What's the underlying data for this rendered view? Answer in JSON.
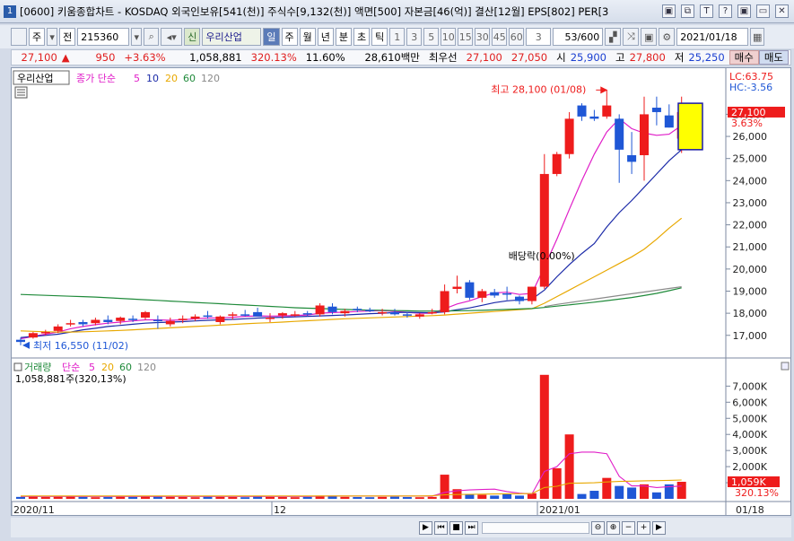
{
  "window": {
    "title": "[0600] 키움종합차트 - KOSDAQ 외국인보유[541(천)] 주식수[9,132(천)] 액면[500] 자본금[46(억)] 결산[12월] EPS[802] PER[3",
    "badge": "1",
    "buttons": [
      "▣",
      "⧉",
      "T",
      "?",
      "▣",
      "▭",
      "✕"
    ]
  },
  "toolbar": {
    "mode": "주",
    "all": "전",
    "code": "215360",
    "new_label": "신",
    "stock_name": "우리산업",
    "periods": [
      "일",
      "주",
      "월",
      "년",
      "분",
      "초",
      "틱"
    ],
    "numbers": [
      "1",
      "3",
      "5",
      "10",
      "15",
      "30",
      "45",
      "60"
    ],
    "count_select": "3",
    "count": "53/600",
    "date": "2021/01/18"
  },
  "info": {
    "price": "27,100",
    "change": "950",
    "change_pct": "+3.63%",
    "volume": "1,058,881",
    "volume_pct": "320.13%",
    "turnover": "11.60%",
    "amount": "28,610백만",
    "priority": "최우선",
    "ask": "27,100",
    "bid": "27,050",
    "open_label": "시",
    "open": "25,900",
    "high_label": "고",
    "high": "27,800",
    "low_label": "저",
    "low": "25,250",
    "buy": "매수",
    "sell": "매도"
  },
  "colors": {
    "up": "#ee1c1c",
    "down": "#1f57d6",
    "ma5": "#e01ec8",
    "ma10": "#1b2aa8",
    "ma20": "#e8a800",
    "ma60": "#1f8a3a",
    "ma120": "#8a8a8a"
  },
  "chart_data": [
    {
      "type": "candlestick",
      "legend": [
        "우리산업",
        "종가 단순",
        "5",
        "10",
        "20",
        "60",
        "120"
      ],
      "ylim": [
        16300,
        28600
      ],
      "yticks": [
        "17,000",
        "18,000",
        "19,000",
        "20,000",
        "21,000",
        "22,000",
        "23,000",
        "24,000",
        "25,000",
        "26,000",
        "27,000"
      ],
      "xlabels": [
        "2020/11",
        "12",
        "2021/01",
        "01/18"
      ],
      "high_annotation": "최고 28,100 (01/08)",
      "low_annotation": "최저 16,550 (11/02)",
      "event_annotation": "배당락(0.00%)",
      "lc": "LC:63.75",
      "hc": "HC:-3.56",
      "last_price": "27,100",
      "last_pct": "3.63%",
      "candles": [
        [
          16800,
          16900,
          16550,
          16700
        ],
        [
          16900,
          17150,
          16850,
          17100
        ],
        [
          17100,
          17250,
          17000,
          17150
        ],
        [
          17200,
          17500,
          17100,
          17400
        ],
        [
          17500,
          17700,
          17400,
          17550
        ],
        [
          17600,
          17700,
          17400,
          17500
        ],
        [
          17550,
          17800,
          17450,
          17700
        ],
        [
          17700,
          17900,
          17500,
          17600
        ],
        [
          17650,
          17850,
          17500,
          17800
        ],
        [
          17750,
          17900,
          17600,
          17700
        ],
        [
          17800,
          18100,
          17700,
          18050
        ],
        [
          17700,
          17900,
          17300,
          17650
        ],
        [
          17500,
          17800,
          17400,
          17650
        ],
        [
          17700,
          17900,
          17550,
          17750
        ],
        [
          17750,
          17950,
          17650,
          17850
        ],
        [
          17900,
          18100,
          17750,
          17850
        ],
        [
          17600,
          17900,
          17500,
          17850
        ],
        [
          17900,
          18050,
          17700,
          17950
        ],
        [
          17950,
          18150,
          17850,
          17900
        ],
        [
          18050,
          18250,
          17950,
          17850
        ],
        [
          17750,
          18000,
          17600,
          17800
        ],
        [
          17900,
          18050,
          17750,
          18000
        ],
        [
          17950,
          18100,
          17850,
          17950
        ],
        [
          18000,
          18100,
          17850,
          17950
        ],
        [
          17950,
          18450,
          17850,
          18350
        ],
        [
          18300,
          18450,
          17950,
          18050
        ],
        [
          18000,
          18200,
          17850,
          18100
        ],
        [
          18200,
          18300,
          18050,
          18150
        ],
        [
          18150,
          18250,
          18050,
          18100
        ],
        [
          18000,
          18200,
          17900,
          18050
        ],
        [
          18050,
          18200,
          17900,
          17950
        ],
        [
          17950,
          18050,
          17800,
          17900
        ],
        [
          17850,
          18000,
          17750,
          17950
        ],
        [
          18000,
          18200,
          17950,
          18050
        ],
        [
          18050,
          19300,
          17950,
          19000
        ],
        [
          19100,
          19700,
          18900,
          19200
        ],
        [
          19400,
          19500,
          18600,
          18700
        ],
        [
          18700,
          19100,
          18500,
          19000
        ],
        [
          18950,
          19100,
          18700,
          18800
        ],
        [
          18900,
          19200,
          18600,
          18850
        ],
        [
          18750,
          18800,
          18400,
          18550
        ],
        [
          18550,
          19200,
          18400,
          19200
        ],
        [
          19200,
          25200,
          19100,
          24300
        ],
        [
          24300,
          25300,
          24200,
          25200
        ],
        [
          25200,
          27100,
          25000,
          26800
        ],
        [
          27400,
          27500,
          26700,
          26900
        ],
        [
          26900,
          27200,
          26700,
          26800
        ],
        [
          26900,
          28100,
          26800,
          27400
        ],
        [
          26800,
          27000,
          23900,
          25400
        ],
        [
          25150,
          26200,
          24300,
          24850
        ],
        [
          25150,
          27800,
          24000,
          27000
        ],
        [
          27300,
          27800,
          26500,
          27100
        ],
        [
          26950,
          27450,
          26400,
          26400
        ],
        [
          25900,
          27800,
          25250,
          27100
        ]
      ],
      "series": [
        {
          "name": "5",
          "values": [
            16850,
            16950,
            17050,
            17150,
            17300,
            17400,
            17480,
            17550,
            17600,
            17650,
            17700,
            17700,
            17680,
            17700,
            17750,
            17780,
            17790,
            17820,
            17860,
            17880,
            17870,
            17880,
            17900,
            17920,
            18000,
            18030,
            18050,
            18080,
            18100,
            18120,
            18080,
            18040,
            18000,
            18000,
            18200,
            18420,
            18560,
            18750,
            18920,
            18950,
            18850,
            18900,
            20100,
            21350,
            22700,
            24000,
            25200,
            26200,
            26800,
            26350,
            26150,
            26050,
            26100,
            26500
          ]
        },
        {
          "name": "10",
          "values": [
            16900,
            16950,
            17000,
            17050,
            17150,
            17250,
            17320,
            17400,
            17450,
            17500,
            17550,
            17580,
            17600,
            17620,
            17650,
            17680,
            17700,
            17720,
            17750,
            17780,
            17800,
            17820,
            17840,
            17860,
            17880,
            17900,
            17920,
            17950,
            17980,
            18000,
            18030,
            18040,
            18030,
            18020,
            18060,
            18160,
            18240,
            18360,
            18480,
            18560,
            18600,
            18640,
            19050,
            19650,
            20200,
            20700,
            21150,
            21900,
            22550,
            23100,
            23700,
            24300,
            24900,
            25400
          ]
        },
        {
          "name": "20",
          "values": [
            17200,
            17180,
            17160,
            17150,
            17150,
            17160,
            17180,
            17200,
            17220,
            17250,
            17280,
            17310,
            17340,
            17370,
            17400,
            17430,
            17460,
            17490,
            17520,
            17550,
            17570,
            17600,
            17630,
            17660,
            17690,
            17720,
            17750,
            17770,
            17790,
            17810,
            17830,
            17850,
            17870,
            17890,
            17920,
            17960,
            18000,
            18040,
            18080,
            18120,
            18160,
            18200,
            18450,
            18750,
            19050,
            19350,
            19650,
            19950,
            20250,
            20550,
            20900,
            21350,
            21850,
            22300
          ]
        },
        {
          "name": "60",
          "values": [
            18850,
            18830,
            18810,
            18790,
            18770,
            18750,
            18730,
            18700,
            18670,
            18640,
            18610,
            18580,
            18550,
            18520,
            18490,
            18460,
            18430,
            18400,
            18370,
            18340,
            18310,
            18280,
            18250,
            18230,
            18210,
            18190,
            18170,
            18150,
            18140,
            18130,
            18120,
            18110,
            18100,
            18100,
            18100,
            18110,
            18120,
            18130,
            18150,
            18170,
            18190,
            18210,
            18260,
            18320,
            18380,
            18440,
            18500,
            18570,
            18640,
            18710,
            18800,
            18900,
            19020,
            19150
          ]
        },
        {
          "name": "120",
          "values": [
            null,
            null,
            null,
            null,
            null,
            null,
            null,
            null,
            null,
            null,
            null,
            null,
            null,
            null,
            null,
            null,
            null,
            null,
            null,
            null,
            null,
            null,
            null,
            null,
            null,
            null,
            null,
            null,
            null,
            null,
            null,
            null,
            null,
            null,
            null,
            null,
            null,
            null,
            null,
            null,
            null,
            null,
            18300,
            18400,
            18480,
            18560,
            18640,
            18720,
            18800,
            18880,
            18960,
            19040,
            19120,
            19200
          ]
        }
      ]
    },
    {
      "type": "bar",
      "legend": [
        "거래량",
        "단순",
        "5",
        "20",
        "60",
        "120"
      ],
      "current": "1,058,881주(320,13%)",
      "ylim": [
        0,
        7800
      ],
      "yticks": [
        "1,000K",
        "2,000K",
        "3,000K",
        "4,000K",
        "5,000K",
        "6,000K",
        "7,000K"
      ],
      "last_value": "1,059K",
      "last_pct": "320.13%",
      "values": [
        120,
        150,
        110,
        130,
        140,
        120,
        100,
        110,
        130,
        120,
        150,
        140,
        120,
        110,
        100,
        130,
        120,
        110,
        100,
        140,
        120,
        110,
        100,
        120,
        200,
        150,
        120,
        110,
        100,
        120,
        130,
        110,
        100,
        120,
        1500,
        600,
        300,
        250,
        200,
        300,
        200,
        350,
        7700,
        1900,
        4000,
        300,
        500,
        1300,
        800,
        700,
        900,
        400,
        900,
        1059
      ],
      "ma5": [
        150,
        150,
        150,
        150,
        150,
        150,
        150,
        150,
        150,
        150,
        150,
        150,
        150,
        150,
        150,
        150,
        150,
        150,
        150,
        150,
        150,
        150,
        150,
        150,
        160,
        170,
        170,
        170,
        170,
        170,
        170,
        170,
        170,
        170,
        400,
        500,
        550,
        580,
        600,
        450,
        350,
        300,
        1700,
        2000,
        2800,
        2900,
        2900,
        2800,
        1400,
        800,
        800,
        700,
        760,
        790
      ],
      "ma20": [
        180,
        180,
        180,
        180,
        180,
        180,
        180,
        180,
        180,
        180,
        180,
        180,
        180,
        180,
        180,
        180,
        180,
        180,
        180,
        180,
        180,
        180,
        180,
        180,
        180,
        180,
        180,
        180,
        180,
        180,
        180,
        180,
        180,
        190,
        250,
        270,
        280,
        290,
        300,
        310,
        320,
        330,
        700,
        780,
        970,
        980,
        1000,
        1050,
        1080,
        1100,
        1120,
        1130,
        1150,
        1170
      ]
    }
  ]
}
